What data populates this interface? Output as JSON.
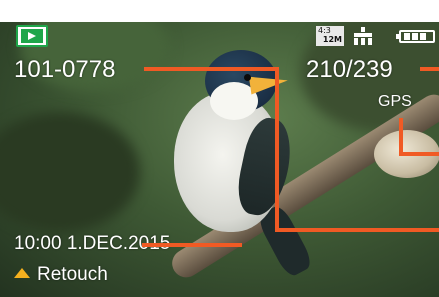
{
  "colors": {
    "callout": "#f05a24",
    "play_icon_green": "#1fa64a",
    "retouch_triangle": "#f5b01e"
  },
  "icons": {
    "play_mode": "playback-icon",
    "aspect": "aspect-ratio-icon",
    "quality": "quality-icon",
    "battery": "battery-icon",
    "retouch": "up-triangle-icon"
  },
  "osd": {
    "file_number": "101-0778",
    "frame_count": "210/239",
    "gps": "GPS",
    "datetime": "10:00  1.DEC.2015",
    "retouch_label": "Retouch",
    "aspect_ratio": "4:3",
    "image_size": "12M"
  }
}
